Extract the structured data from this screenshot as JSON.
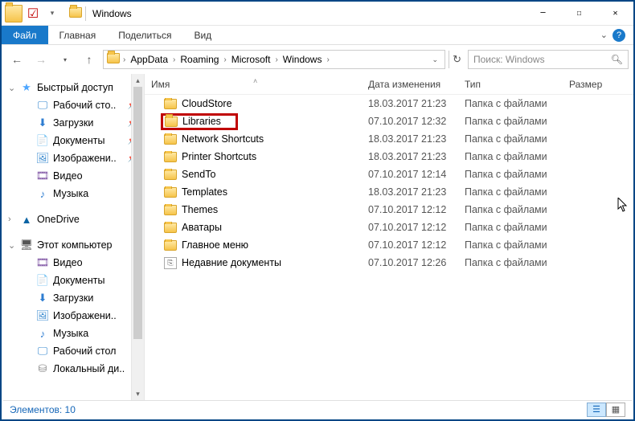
{
  "window": {
    "title": "Windows"
  },
  "ribbon": {
    "file": "Файл",
    "tabs": [
      "Главная",
      "Поделиться",
      "Вид"
    ]
  },
  "nav": {
    "crumbs": [
      "AppData",
      "Roaming",
      "Microsoft",
      "Windows"
    ],
    "search_placeholder": "Поиск: Windows"
  },
  "columns": {
    "name": "Имя",
    "date": "Дата изменения",
    "type": "Тип",
    "size": "Размер"
  },
  "sidebar": {
    "quick": {
      "label": "Быстрый доступ",
      "items": [
        {
          "icon": "desktop",
          "label": "Рабочий сто..",
          "pinned": true
        },
        {
          "icon": "download",
          "label": "Загрузки",
          "pinned": true
        },
        {
          "icon": "document",
          "label": "Документы",
          "pinned": true
        },
        {
          "icon": "picture",
          "label": "Изображени..",
          "pinned": true
        },
        {
          "icon": "video",
          "label": "Видео",
          "pinned": false
        },
        {
          "icon": "music",
          "label": "Музыка",
          "pinned": false
        }
      ]
    },
    "onedrive": {
      "label": "OneDrive"
    },
    "thispc": {
      "label": "Этот компьютер",
      "items": [
        {
          "icon": "video",
          "label": "Видео"
        },
        {
          "icon": "document",
          "label": "Документы"
        },
        {
          "icon": "download",
          "label": "Загрузки"
        },
        {
          "icon": "picture",
          "label": "Изображени.."
        },
        {
          "icon": "music",
          "label": "Музыка"
        },
        {
          "icon": "desktop",
          "label": "Рабочий стол"
        },
        {
          "icon": "disk",
          "label": "Локальный ди.."
        }
      ]
    }
  },
  "files": [
    {
      "name": "CloudStore",
      "date": "18.03.2017 21:23",
      "type": "Папка с файлами",
      "icon": "folder"
    },
    {
      "name": "Libraries",
      "date": "07.10.2017 12:32",
      "type": "Папка с файлами",
      "icon": "folder",
      "hl": true
    },
    {
      "name": "Network Shortcuts",
      "date": "18.03.2017 21:23",
      "type": "Папка с файлами",
      "icon": "folder"
    },
    {
      "name": "Printer Shortcuts",
      "date": "18.03.2017 21:23",
      "type": "Папка с файлами",
      "icon": "folder"
    },
    {
      "name": "SendTo",
      "date": "07.10.2017 12:14",
      "type": "Папка с файлами",
      "icon": "folder"
    },
    {
      "name": "Templates",
      "date": "18.03.2017 21:23",
      "type": "Папка с файлами",
      "icon": "folder"
    },
    {
      "name": "Themes",
      "date": "07.10.2017 12:12",
      "type": "Папка с файлами",
      "icon": "folder"
    },
    {
      "name": "Аватары",
      "date": "07.10.2017 12:12",
      "type": "Папка с файлами",
      "icon": "folder"
    },
    {
      "name": "Главное меню",
      "date": "07.10.2017 12:12",
      "type": "Папка с файлами",
      "icon": "folder"
    },
    {
      "name": "Недавние документы",
      "date": "07.10.2017 12:26",
      "type": "Папка с файлами",
      "icon": "shortcut"
    }
  ],
  "status": {
    "count_label": "Элементов: 10"
  }
}
